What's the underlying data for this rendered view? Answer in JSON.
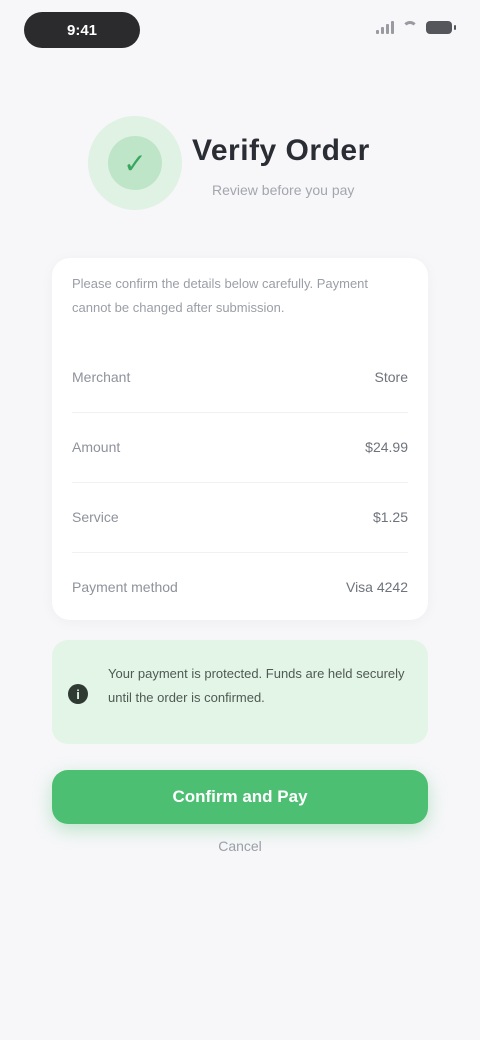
{
  "status_bar": {
    "time": "9:41"
  },
  "header": {
    "logo_icon": "leaf-icon",
    "title": "Verify Order",
    "subtitle": "Review before you pay"
  },
  "card": {
    "description": "Please confirm the details below carefully. Payment cannot be changed after submission.",
    "rows": [
      {
        "label": "Merchant",
        "value": "Store"
      },
      {
        "label": "Amount",
        "value": "$24.99"
      },
      {
        "label": "Service",
        "value": "$1.25"
      },
      {
        "label": "Payment method",
        "value": "Visa 4242"
      }
    ]
  },
  "notice": {
    "icon": "info-icon",
    "text": "Your payment is protected. Funds are held securely until the order is confirmed."
  },
  "actions": {
    "primary_label": "Confirm and Pay",
    "secondary_label": "Cancel"
  },
  "colors": {
    "accent": "#4cbf73",
    "notice_bg": "#e3f5e7",
    "background": "#f7f7f9"
  }
}
